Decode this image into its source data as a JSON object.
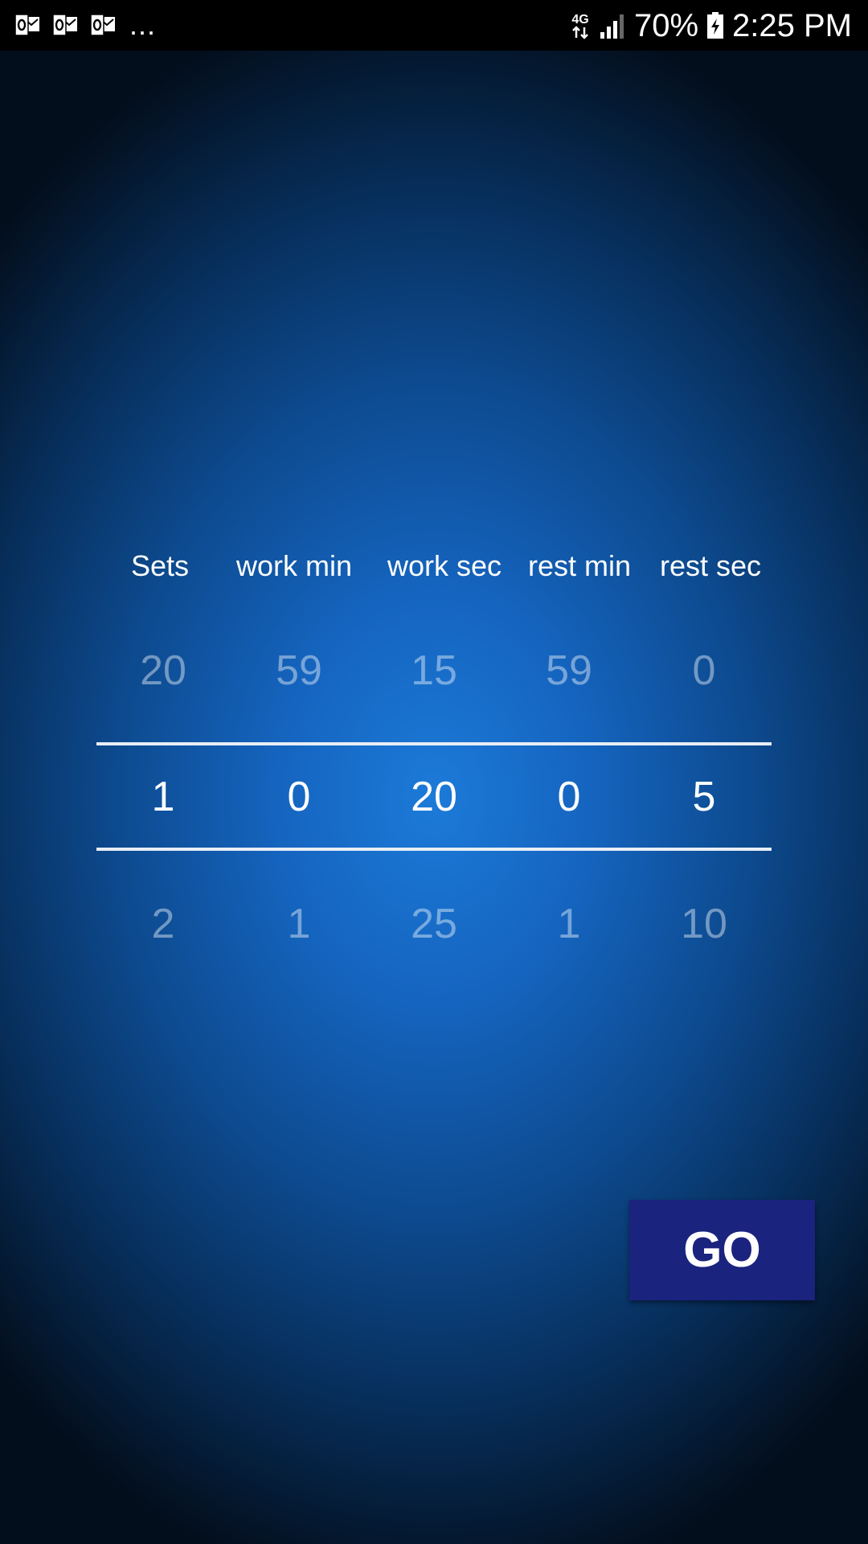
{
  "status_bar": {
    "notification_icons": [
      "outlook-icon",
      "outlook-icon",
      "outlook-icon"
    ],
    "more_indicator": "...",
    "network_type": "4G",
    "battery_percent": "70%",
    "time": "2:25 PM"
  },
  "picker": {
    "columns": [
      {
        "header": "Sets",
        "prev": "20",
        "current": "1",
        "next": "2"
      },
      {
        "header": "work min",
        "prev": "59",
        "current": "0",
        "next": "1"
      },
      {
        "header": "work sec",
        "prev": "15",
        "current": "20",
        "next": "25"
      },
      {
        "header": "rest min",
        "prev": "59",
        "current": "0",
        "next": "1"
      },
      {
        "header": "rest sec",
        "prev": "0",
        "current": "5",
        "next": "10"
      }
    ]
  },
  "go_button": {
    "label": "GO"
  },
  "colors": {
    "background_center": "#1c7ad8",
    "background_edge": "#030e1c",
    "go_button_bg": "#1a237e",
    "divider": "#e8eef5"
  }
}
